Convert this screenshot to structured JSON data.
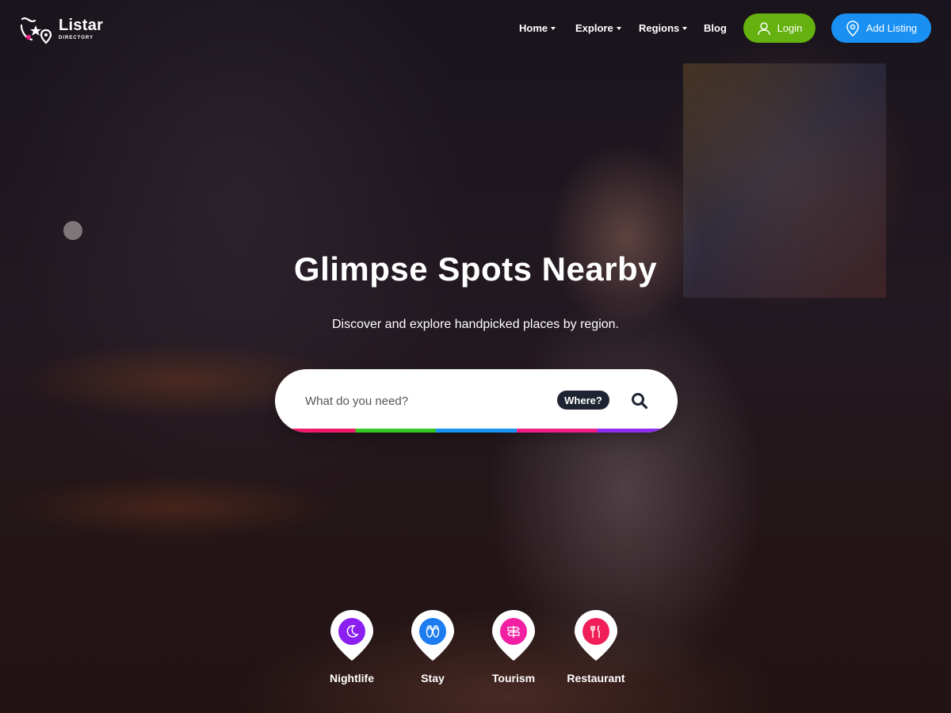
{
  "brand": {
    "name": "Listar",
    "tagline": "DIRECTORY"
  },
  "nav": {
    "items": [
      {
        "label": "Home",
        "dropdown": true
      },
      {
        "label": "Explore",
        "dropdown": true
      },
      {
        "label": "Regions",
        "dropdown": true
      },
      {
        "label": "Blog",
        "dropdown": false
      }
    ],
    "login_label": "Login",
    "add_listing_label": "Add Listing"
  },
  "hero": {
    "title": "Glimpse Spots Nearby",
    "subtitle": "Discover and explore handpicked places by region."
  },
  "search": {
    "placeholder": "What do you need?",
    "where_label": "Where?",
    "search_icon": "search-icon"
  },
  "categories": [
    {
      "label": "Nightlife",
      "icon": "moon-icon",
      "color": "#8a1ff0"
    },
    {
      "label": "Stay",
      "icon": "flip-flops-icon",
      "color": "#1c7cf0"
    },
    {
      "label": "Tourism",
      "icon": "signpost-icon",
      "color": "#f21fa3"
    },
    {
      "label": "Restaurant",
      "icon": "cutlery-icon",
      "color": "#f01f5a"
    }
  ],
  "colors": {
    "login_green": "#64b10f",
    "add_listing_blue": "#1a91f2",
    "where_badge": "#1f2432"
  }
}
